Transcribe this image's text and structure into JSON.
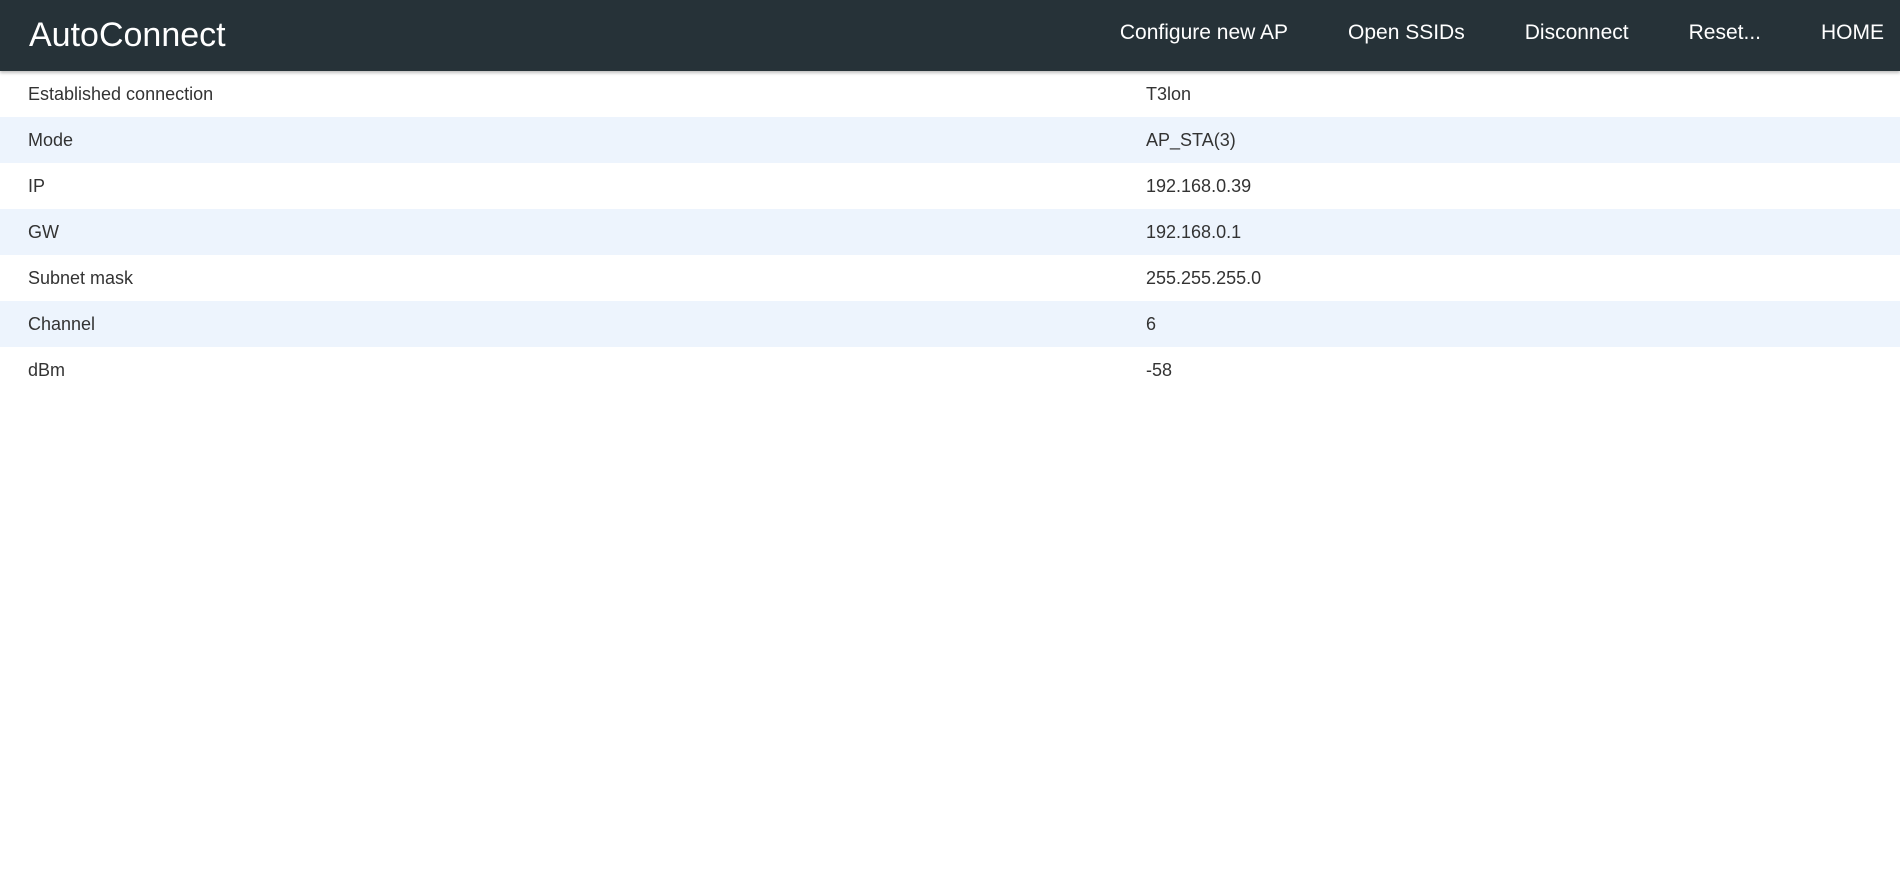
{
  "header": {
    "brand": "AutoConnect",
    "nav": [
      {
        "label": "Configure new AP"
      },
      {
        "label": "Open SSIDs"
      },
      {
        "label": "Disconnect"
      },
      {
        "label": "Reset..."
      },
      {
        "label": "HOME"
      }
    ]
  },
  "status": {
    "rows": [
      {
        "label": "Established connection",
        "value": "T3lon"
      },
      {
        "label": "Mode",
        "value": "AP_STA(3)"
      },
      {
        "label": "IP",
        "value": "192.168.0.39"
      },
      {
        "label": "GW",
        "value": "192.168.0.1"
      },
      {
        "label": "Subnet mask",
        "value": "255.255.255.0"
      },
      {
        "label": "Channel",
        "value": "6"
      },
      {
        "label": "dBm",
        "value": "-58"
      }
    ]
  }
}
